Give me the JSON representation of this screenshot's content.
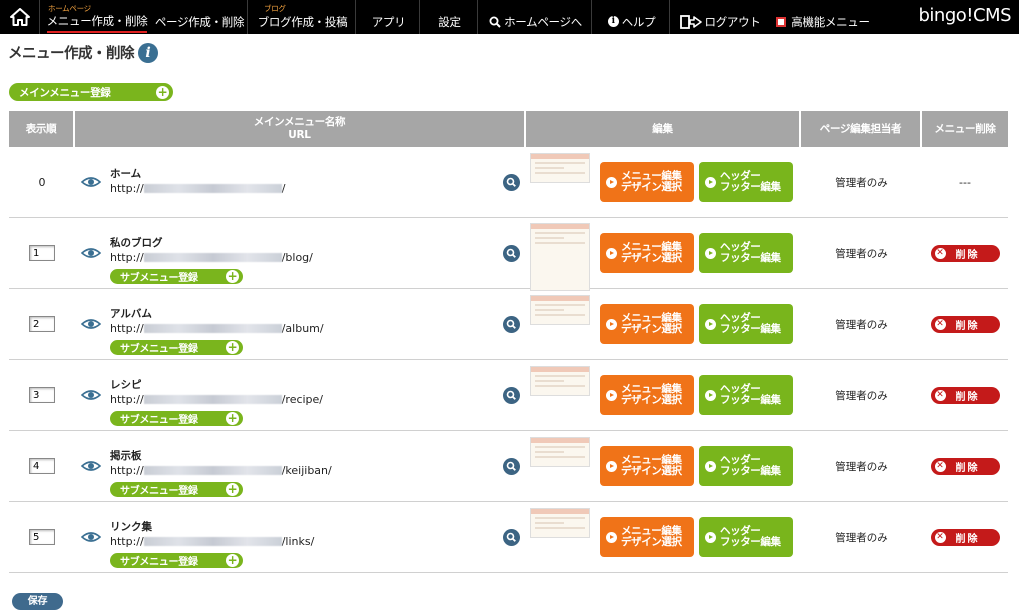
{
  "topbar": {
    "home_icon": "home-icon",
    "menu_sub": "ホームページ",
    "menu_label": "メニュー作成・削除",
    "page_label": "ページ作成・削除",
    "blog_sub": "ブログ",
    "blog_label": "ブログ作成・投稿",
    "apps_label": "アプリ",
    "settings_label": "設定",
    "homepage_label": "ホームページへ",
    "help_label": "ヘルプ",
    "logout_label": "ログアウト",
    "advanced_label": "高機能メニュー",
    "brand": "bingo!CMS"
  },
  "page": {
    "title": "メニュー作成・削除",
    "info_icon": "i",
    "add_main_menu": "メインメニュー登録",
    "save": "保存"
  },
  "table": {
    "headers": {
      "order": "表示順",
      "name": "メインメニュー名称",
      "url": "URL",
      "edit": "編集",
      "manager": "ページ編集担当者",
      "delete": "メニュー削除"
    },
    "rows": [
      {
        "order": "0",
        "name": "ホーム",
        "url_prefix": "http://",
        "url_suffix": "/",
        "menu_btn_1": "メニュー編集",
        "menu_btn_2": "デザイン選択",
        "hf_btn_1": "ヘッダー",
        "hf_btn_2": "フッター編集",
        "manager": "管理者のみ",
        "delete": "---"
      },
      {
        "order": "1",
        "name": "私のブログ",
        "url_prefix": "http://",
        "url_suffix": "/blog/",
        "submenu": "サブメニュー登録",
        "menu_btn_1": "メニュー編集",
        "menu_btn_2": "デザイン選択",
        "hf_btn_1": "ヘッダー",
        "hf_btn_2": "フッター編集",
        "manager": "管理者のみ",
        "delete": "削除"
      },
      {
        "order": "2",
        "name": "アルバム",
        "url_prefix": "http://",
        "url_suffix": "/album/",
        "submenu": "サブメニュー登録",
        "menu_btn_1": "メニュー編集",
        "menu_btn_2": "デザイン選択",
        "hf_btn_1": "ヘッダー",
        "hf_btn_2": "フッター編集",
        "manager": "管理者のみ",
        "delete": "削除"
      },
      {
        "order": "3",
        "name": "レシピ",
        "url_prefix": "http://",
        "url_suffix": "/recipe/",
        "submenu": "サブメニュー登録",
        "menu_btn_1": "メニュー編集",
        "menu_btn_2": "デザイン選択",
        "hf_btn_1": "ヘッダー",
        "hf_btn_2": "フッター編集",
        "manager": "管理者のみ",
        "delete": "削除"
      },
      {
        "order": "4",
        "name": "掲示板",
        "url_prefix": "http://",
        "url_suffix": "/keijiban/",
        "submenu": "サブメニュー登録",
        "menu_btn_1": "メニュー編集",
        "menu_btn_2": "デザイン選択",
        "hf_btn_1": "ヘッダー",
        "hf_btn_2": "フッター編集",
        "manager": "管理者のみ",
        "delete": "削除"
      },
      {
        "order": "5",
        "name": "リンク集",
        "url_prefix": "http://",
        "url_suffix": "/links/",
        "submenu": "サブメニュー登録",
        "menu_btn_1": "メニュー編集",
        "menu_btn_2": "デザイン選択",
        "hf_btn_1": "ヘッダー",
        "hf_btn_2": "フッター編集",
        "manager": "管理者のみ",
        "delete": "削除"
      }
    ]
  },
  "colors": {
    "orange": "#f07318",
    "green": "#79b51c",
    "red": "#c41a1a",
    "header_gray": "#a6a6a6",
    "navy": "#3f6a8d"
  }
}
